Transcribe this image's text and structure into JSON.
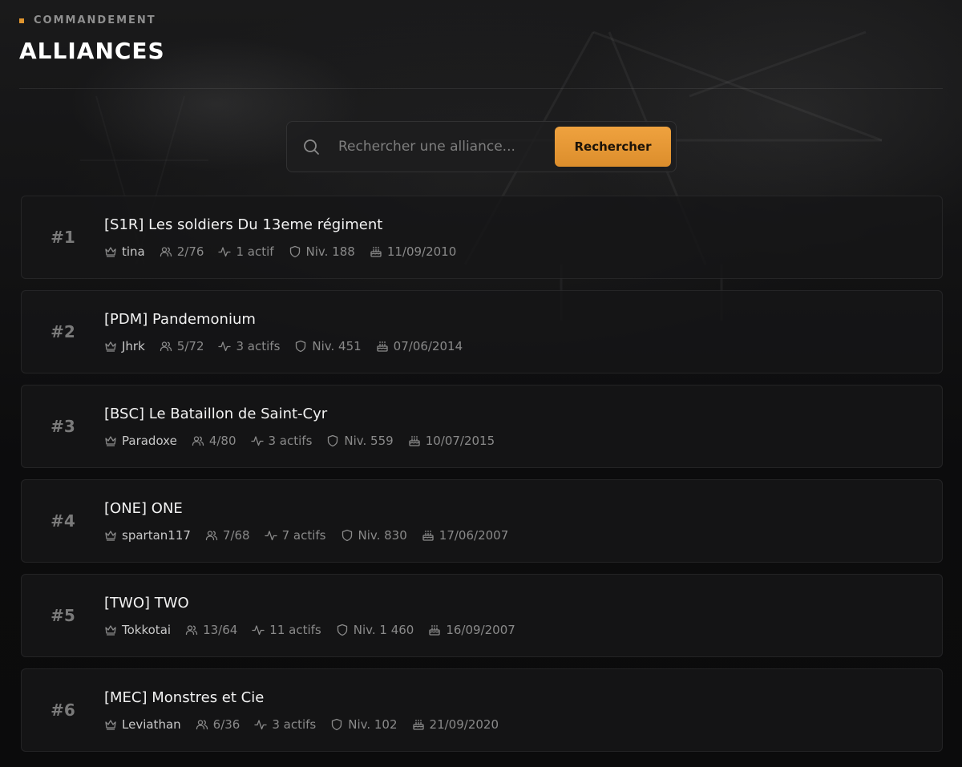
{
  "header": {
    "kicker": "COMMANDEMENT",
    "title": "ALLIANCES"
  },
  "search": {
    "placeholder": "Rechercher une alliance...",
    "value": "",
    "button_label": "Rechercher"
  },
  "colors": {
    "accent": "#e8993a",
    "background": "#0c0c0d",
    "card": "#161617",
    "muted_text": "#8a8a8a"
  },
  "alliances": [
    {
      "rank": "#1",
      "name": "[S1R] Les soldiers Du 13eme régiment",
      "leader": "tina",
      "members": "2/76",
      "active": "1 actif",
      "level": "Niv. 188",
      "founded": "11/09/2010"
    },
    {
      "rank": "#2",
      "name": "[PDM] Pandemonium",
      "leader": "Jhrk",
      "members": "5/72",
      "active": "3 actifs",
      "level": "Niv. 451",
      "founded": "07/06/2014"
    },
    {
      "rank": "#3",
      "name": "[BSC] Le Bataillon de Saint-Cyr",
      "leader": "Paradoxe",
      "members": "4/80",
      "active": "3 actifs",
      "level": "Niv. 559",
      "founded": "10/07/2015"
    },
    {
      "rank": "#4",
      "name": "[ONE] ONE",
      "leader": "spartan117",
      "members": "7/68",
      "active": "7 actifs",
      "level": "Niv. 830",
      "founded": "17/06/2007"
    },
    {
      "rank": "#5",
      "name": "[TWO] TWO",
      "leader": "Tokkotai",
      "members": "13/64",
      "active": "11 actifs",
      "level": "Niv. 1 460",
      "founded": "16/09/2007"
    },
    {
      "rank": "#6",
      "name": "[MEC] Monstres et Cie",
      "leader": "Leviathan",
      "members": "6/36",
      "active": "3 actifs",
      "level": "Niv. 102",
      "founded": "21/09/2020"
    }
  ],
  "icons": {
    "search": "search-icon",
    "leader": "crown-icon",
    "members": "users-icon",
    "active": "activity-icon",
    "level": "shield-icon",
    "founded": "cake-icon"
  }
}
